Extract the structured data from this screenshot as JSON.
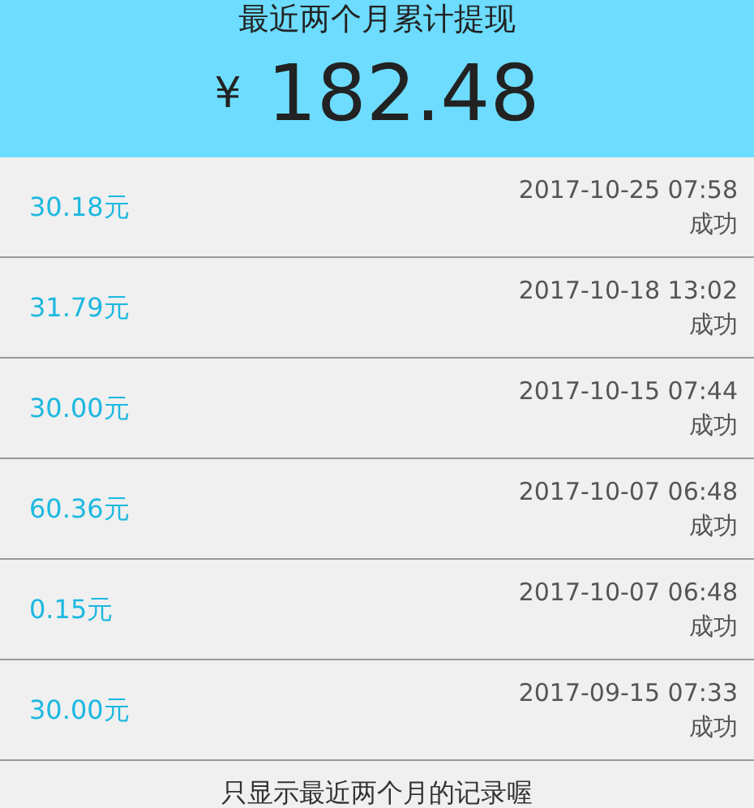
{
  "header": {
    "title": "最近两个月累计提现",
    "currency": "¥",
    "total": "182.48"
  },
  "records": [
    {
      "amount": "30.18元",
      "time": "2017-10-25 07:58",
      "status": "成功"
    },
    {
      "amount": "31.79元",
      "time": "2017-10-18 13:02",
      "status": "成功"
    },
    {
      "amount": "30.00元",
      "time": "2017-10-15 07:44",
      "status": "成功"
    },
    {
      "amount": "60.36元",
      "time": "2017-10-07 06:48",
      "status": "成功"
    },
    {
      "amount": "0.15元",
      "time": "2017-10-07 06:48",
      "status": "成功"
    },
    {
      "amount": "30.00元",
      "time": "2017-09-15 07:33",
      "status": "成功"
    }
  ],
  "footer_note": "只显示最近两个月的记录喔"
}
